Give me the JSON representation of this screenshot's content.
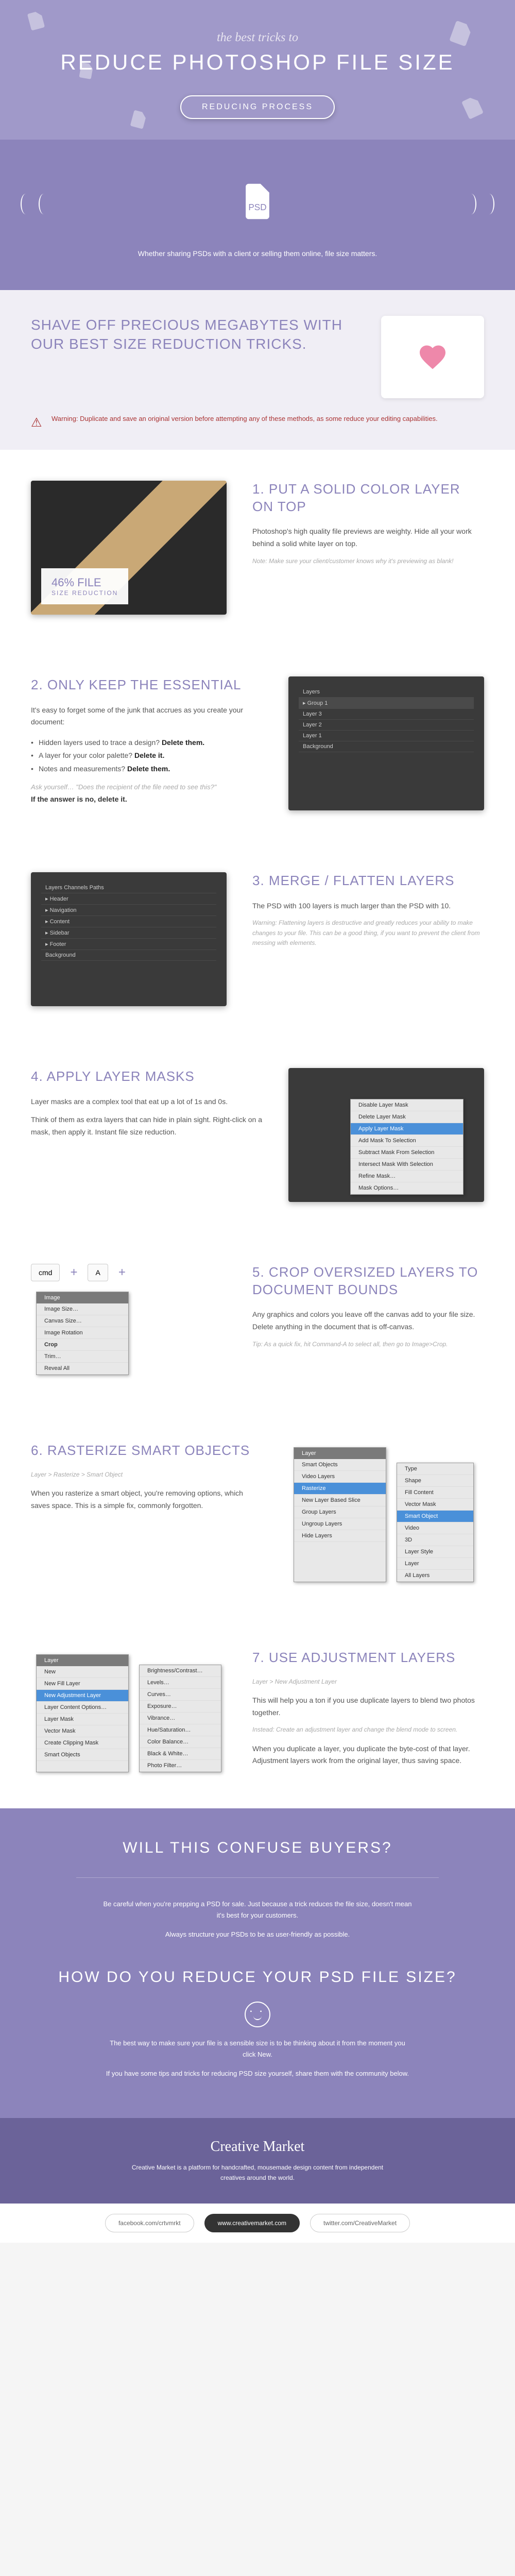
{
  "hero": {
    "script": "the best tricks to",
    "title": "REDUCE PHOTOSHOP FILE SIZE",
    "button": "REDUCING PROCESS",
    "subtitle": "Whether sharing PSDs with a client\nor selling them online, file size matters."
  },
  "intro": {
    "title": "SHAVE OFF PRECIOUS MEGABYTES WITH OUR BEST SIZE REDUCTION TRICKS.",
    "warning": "Warning: Duplicate and save an original version before attempting any of these methods, as some reduce your editing capabilities."
  },
  "tips": [
    {
      "num": "1.",
      "title": "PUT A SOLID COLOR LAYER ON TOP",
      "desc": "Photoshop's high quality file previews are weighty. Hide all your work behind a solid white layer on top.",
      "note": "Note: Make sure your client/customer knows why it's previewing as blank!",
      "badge": {
        "big": "46% FILE",
        "small": "SIZE REDUCTION"
      }
    },
    {
      "num": "2.",
      "title": "ONLY KEEP THE ESSENTIAL",
      "desc": "It's easy to forget some of the junk that accrues as you create your document:",
      "list": [
        {
          "text": "Hidden layers used to trace a design?",
          "action": "Delete them."
        },
        {
          "text": "A layer for your color palette?",
          "action": "Delete it."
        },
        {
          "text": "Notes and measurements?",
          "action": "Delete them."
        }
      ],
      "ask": "Ask yourself… \"Does the recipient of the file need to see this?\"",
      "answer": "If the answer is no, delete it."
    },
    {
      "num": "3.",
      "title": "MERGE / FLATTEN LAYERS",
      "desc": "The PSD with 100 layers is much larger than the PSD with 10.",
      "note": "Warning: Flattening layers is destructive and greatly reduces your ability to make changes to your file. This can be a good thing, if you want to prevent the client from messing with elements."
    },
    {
      "num": "4.",
      "title": "APPLY LAYER MASKS",
      "desc": "Layer masks are a complex tool that eat up a lot of 1s and 0s.",
      "desc2": "Think of them as extra layers that can hide in plain sight. Right-click on a mask, then apply it. Instant file size reduction.",
      "menu": [
        "Disable Layer Mask",
        "Delete Layer Mask",
        "Apply Layer Mask",
        "Add Mask To Selection",
        "Subtract Mask From Selection",
        "Intersect Mask With Selection",
        "Refine Mask…",
        "Mask Options…"
      ]
    },
    {
      "num": "5.",
      "title": "CROP OVERSIZED LAYERS TO DOCUMENT BOUNDS",
      "desc": "Any graphics and colors you leave off the canvas add to your file size. Delete anything in the document that is off-canvas.",
      "note": "Tip: As a quick fix, hit Command-A to select all, then go to Image>Crop.",
      "keys": [
        "cmd",
        "A"
      ],
      "image_menu_head": "Image",
      "image_menu": [
        "Image Size…",
        "Canvas Size…",
        "Image Rotation",
        "Crop",
        "Trim…",
        "Reveal All"
      ]
    },
    {
      "num": "6.",
      "title": "RASTERIZE SMART OBJECTS",
      "sub": "Layer > Rasterize > Smart Object",
      "desc": "When you rasterize a smart object, you're removing options, which saves space. This is a simple fix, commonly forgotten.",
      "layer_menu_head": "Layer",
      "layer_menu": [
        "Smart Objects",
        "Video Layers",
        "Rasterize",
        "New Layer Based Slice",
        "Group Layers",
        "Ungroup Layers",
        "Hide Layers"
      ],
      "sub_menu": [
        "Type",
        "Shape",
        "Fill Content",
        "Vector Mask",
        "Smart Object",
        "Video",
        "3D",
        "Layer Style",
        "Layer",
        "All Layers"
      ]
    },
    {
      "num": "7.",
      "title": "USE ADJUSTMENT LAYERS",
      "sub": "Layer > New Adjustment Layer",
      "desc": "This will help you a ton if you use duplicate layers to blend two photos together.",
      "note": "Instead: Create an adjustment layer and change the blend mode to screen.",
      "desc2": "When you duplicate a layer, you duplicate the byte-cost of that layer. Adjustment layers work from the original layer, thus saving space.",
      "layer_menu_head": "Layer",
      "layer_menu": [
        "New",
        "New Fill Layer",
        "New Adjustment Layer",
        "Layer Content Options…",
        "Layer Mask",
        "Vector Mask",
        "Create Clipping Mask",
        "Smart Objects"
      ],
      "sub_menu": [
        "Brightness/Contrast…",
        "Levels…",
        "Curves…",
        "Exposure…",
        "Vibrance…",
        "Hue/Saturation…",
        "Color Balance…",
        "Black & White…",
        "Photo Filter…"
      ]
    }
  ],
  "confuse": {
    "title1": "WILL THIS CONFUSE BUYERS?",
    "p1": "Be careful when you're prepping a PSD for sale. Just because a trick reduces the file size, doesn't mean it's best for your customers.",
    "p2": "Always structure your PSDs to be as user-friendly as possible.",
    "title2": "HOW DO YOU REDUCE YOUR PSD FILE SIZE?",
    "p3": "The best way to make sure your file is a sensible size is to be thinking about it from the moment you click New.",
    "p4": "If you have some tips and tricks for reducing PSD size yourself, share them with the community below."
  },
  "footer": {
    "logo": "Creative Market",
    "desc": "Creative Market is a platform for handcrafted, mousemade design content from independent creatives around the world."
  },
  "social": {
    "fb": "facebook.com/crtvmrkt",
    "main": "www.creativemarket.com",
    "tw": "twitter.com/CreativeMarket"
  }
}
